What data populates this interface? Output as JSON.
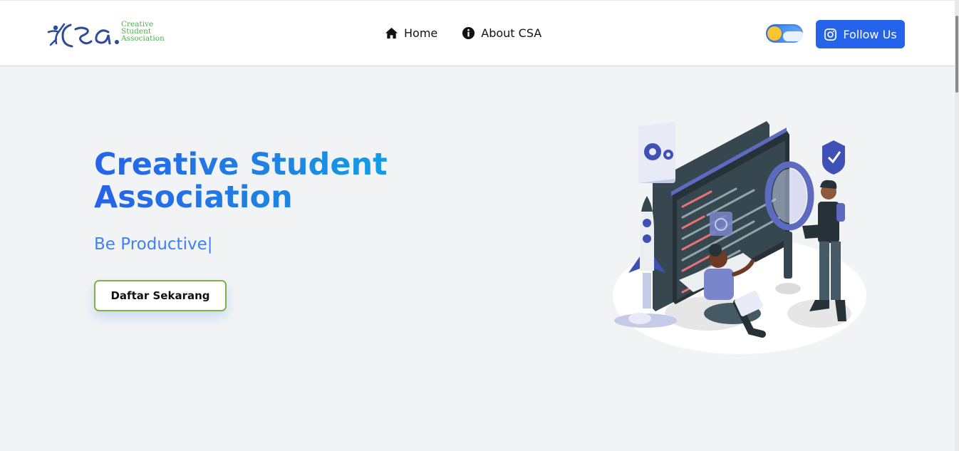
{
  "brand": {
    "logo_mark": "CSA",
    "logo_lines": [
      "Creative",
      "Student",
      "Association"
    ],
    "green": "#4caf50",
    "blue": "#2d4b9a"
  },
  "nav": {
    "items": [
      {
        "label": "Home",
        "icon": "home-icon"
      },
      {
        "label": "About CSA",
        "icon": "info-icon"
      }
    ]
  },
  "header": {
    "theme_toggle": {
      "state": "light",
      "icon": "sun-cloud-icon"
    },
    "follow_button": {
      "label": "Follow Us",
      "icon": "instagram-icon",
      "color": "#2563eb"
    }
  },
  "hero": {
    "title_line1": "Creative Student",
    "title_line2": "Association",
    "subtitle": "Be Productive",
    "cursor": "|",
    "cta_label": "Daftar Sekarang",
    "accent": "#2563eb",
    "cta_border": "#7cb342"
  },
  "illustration": {
    "icon": "developer-team-illustration"
  }
}
